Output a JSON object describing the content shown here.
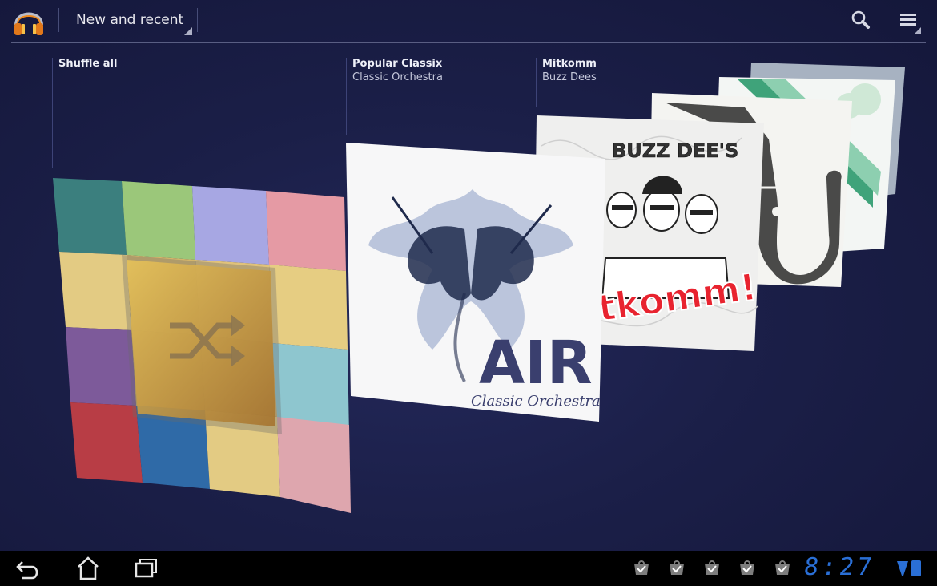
{
  "actionbar": {
    "view_selector_label": "New and recent"
  },
  "carousel": {
    "items": [
      {
        "title": "Shuffle all",
        "artist": ""
      },
      {
        "title": "Popular Classix",
        "artist": "Classic Orchestra"
      },
      {
        "title": "Mitkomm",
        "artist": "Buzz Dees"
      }
    ],
    "art": {
      "air_big": "AIR",
      "air_sub": "Classic Orchestra",
      "buzz_logo": "BUZZ DEE'S",
      "mitkomm_text": "tkomm!"
    }
  },
  "navbar": {
    "clock": "8:27"
  },
  "colors": {
    "background": "#1b1f48",
    "accent_clock": "#2a6fd6",
    "divider": "#6a6f93"
  },
  "icons": {
    "app": "headphones-icon",
    "search": "search-icon",
    "menu": "menu-icon",
    "back": "back-icon",
    "home": "home-icon",
    "recents": "recent-apps-icon",
    "notification": "download-complete-icon",
    "battery": "battery-icon"
  }
}
